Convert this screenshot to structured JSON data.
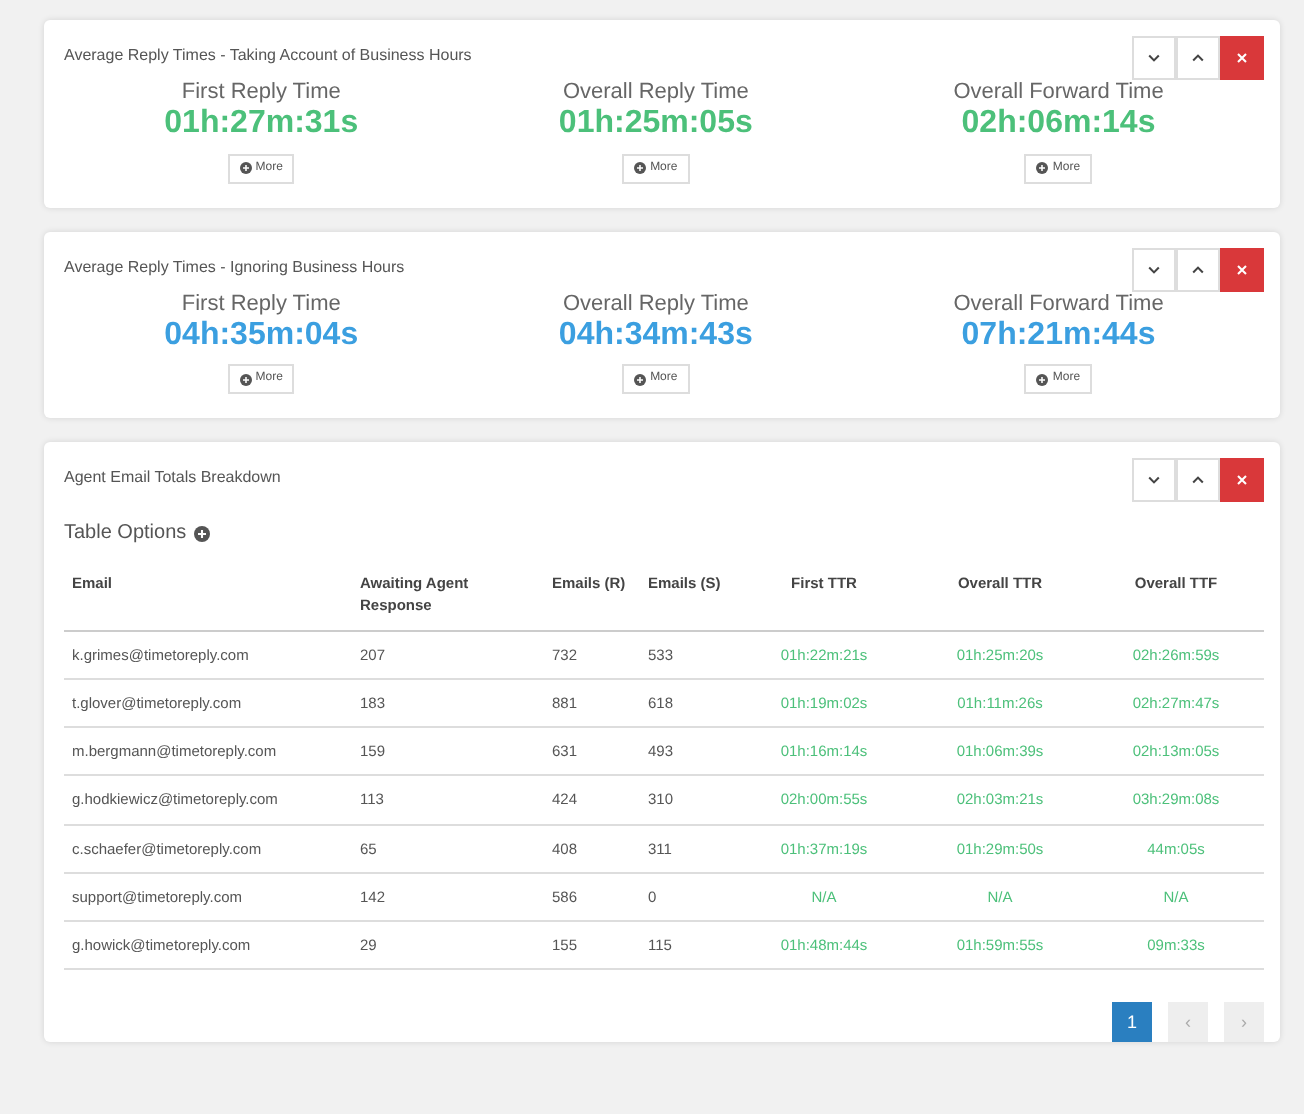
{
  "panels": [
    {
      "title": "Average Reply Times - Taking Account of Business Hours",
      "color": "#4cc07a",
      "stats": [
        {
          "label": "First Reply Time",
          "value": "01h:27m:31s",
          "button": "More"
        },
        {
          "label": "Overall Reply Time",
          "value": "01h:25m:05s",
          "button": "More"
        },
        {
          "label": "Overall Forward Time",
          "value": "02h:06m:14s",
          "button": "More"
        }
      ]
    },
    {
      "title": "Average Reply Times - Ignoring Business Hours",
      "color": "#3b9fe0",
      "stats": [
        {
          "label": "First Reply Time",
          "value": "04h:35m:04s",
          "button": "More"
        },
        {
          "label": "Overall Reply Time",
          "value": "04h:34m:43s",
          "button": "More"
        },
        {
          "label": "Overall Forward Time",
          "value": "07h:21m:44s",
          "button": "More"
        }
      ]
    }
  ],
  "breakdown": {
    "title": "Agent Email Totals Breakdown",
    "options_label": "Table Options",
    "columns": [
      {
        "label": "Email",
        "kind": "text"
      },
      {
        "label": "Awaiting Agent Response",
        "kind": "text"
      },
      {
        "label": "Emails (R)",
        "kind": "text"
      },
      {
        "label": "Emails (S)",
        "kind": "text"
      },
      {
        "label": "First TTR",
        "kind": "time"
      },
      {
        "label": "Overall TTR",
        "kind": "time"
      },
      {
        "label": "Overall TTF",
        "kind": "time"
      }
    ],
    "rows": [
      [
        "k.grimes@timetoreply.com",
        "207",
        "732",
        "533",
        "01h:22m:21s",
        "01h:25m:20s",
        "02h:26m:59s"
      ],
      [
        "t.glover@timetoreply.com",
        "183",
        "881",
        "618",
        "01h:19m:02s",
        "01h:11m:26s",
        "02h:27m:47s"
      ],
      [
        "m.bergmann@timetoreply.com",
        "159",
        "631",
        "493",
        "01h:16m:14s",
        "01h:06m:39s",
        "02h:13m:05s"
      ],
      [
        "g.hodkiewicz@timetoreply.com",
        "113",
        "424",
        "310",
        "02h:00m:55s",
        "02h:03m:21s",
        "03h:29m:08s"
      ],
      [
        "c.schaefer@timetoreply.com",
        "65",
        "408",
        "311",
        "01h:37m:19s",
        "01h:29m:50s",
        "44m:05s"
      ],
      [
        "support@timetoreply.com",
        "142",
        "586",
        "0",
        "N/A",
        "N/A",
        "N/A"
      ],
      [
        "g.howick@timetoreply.com",
        "29",
        "155",
        "115",
        "01h:48m:44s",
        "01h:59m:55s",
        "09m:33s"
      ]
    ],
    "pages": [
      {
        "label": "1",
        "selected": true
      }
    ],
    "prev": {
      "label": "‹",
      "disabled": true
    },
    "next": {
      "label": "›",
      "disabled": true
    }
  }
}
